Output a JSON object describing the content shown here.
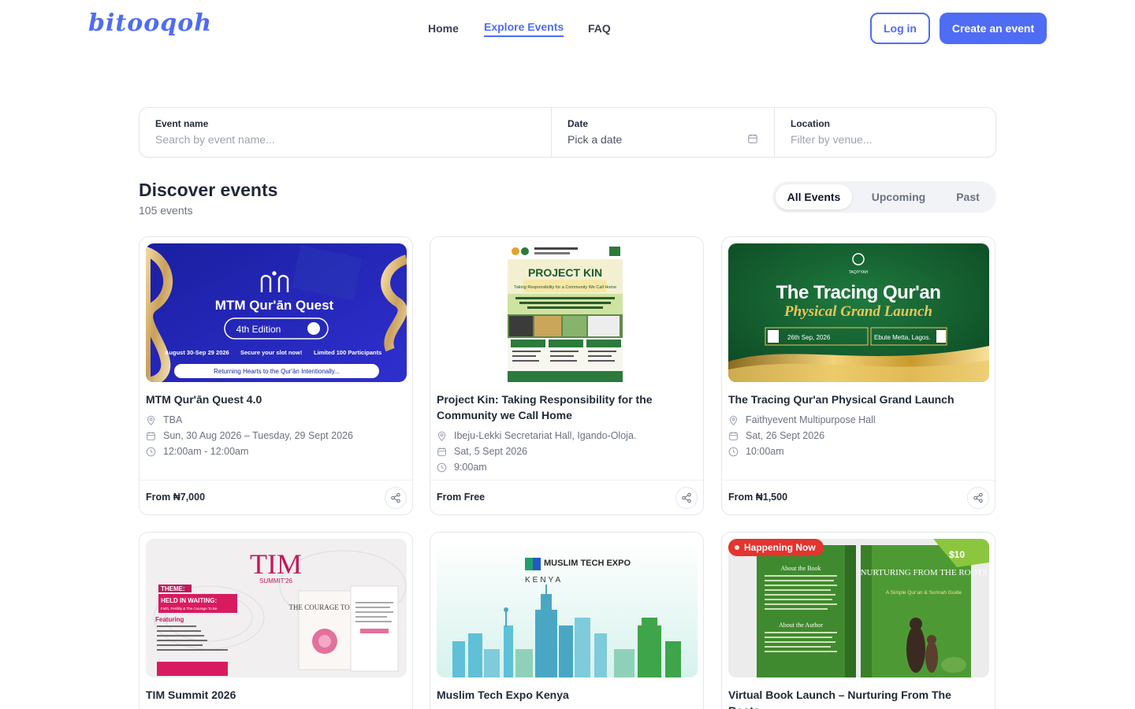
{
  "header": {
    "logo": "bitooqoh",
    "nav": [
      {
        "label": "Home"
      },
      {
        "label": "Explore Events"
      },
      {
        "label": "FAQ"
      }
    ],
    "login_label": "Log in",
    "create_label": "Create an event"
  },
  "search": {
    "event_name_label": "Event name",
    "event_name_placeholder": "Search by event name...",
    "date_label": "Date",
    "date_value": "Pick a date",
    "location_label": "Location",
    "location_placeholder": "Filter by venue..."
  },
  "discover": {
    "title": "Discover events",
    "count": "105 events",
    "tabs": [
      "All Events",
      "Upcoming",
      "Past"
    ],
    "active_tab": "All Events"
  },
  "events": [
    {
      "title": "MTM Qur'ān Quest 4.0",
      "location": "TBA",
      "date": "Sun, 30 Aug 2026 – Tuesday, 29 Sept 2026",
      "time": "12:00am - 12:00am",
      "price": "From ₦7,000",
      "image": {
        "heading": "MTM Qur'ān Quest",
        "edition": "4th Edition",
        "info": [
          "August 30-Sep 29 2026",
          "Secure your slot now!",
          "Limited 100 Participants"
        ],
        "tagline": "Returning Hearts to the Qur'ān Intentionally..."
      }
    },
    {
      "title": "Project Kin: Taking Responsibility for the Community we Call Home",
      "location": "Ibeju-Lekki Secretariat Hall, Igando-Oloja.",
      "date": "Sat, 5 Sept 2026",
      "time": "9:00am",
      "price": "From Free",
      "image": {
        "heading": "PROJECT KIN",
        "subheading": "Taking Responsibility for a Community We Call Home"
      }
    },
    {
      "title": "The Tracing Qur'an Physical Grand Launch",
      "location": "Faithyevent Multipurpose Hall",
      "date": "Sat, 26 Sept 2026",
      "time": "10:00am",
      "price": "From ₦1,500",
      "image": {
        "brand": "TAQIYYAH",
        "heading": "The Tracing Qur'an",
        "subheading": "Physical Grand Launch",
        "date_chip": "26th Sep, 2026",
        "location_chip": "Ebute Metta, Lagos."
      }
    },
    {
      "title": "TIM Summit 2026",
      "image": {
        "heading": "TIM",
        "sub": "SUMMIT'26",
        "theme_label": "THEME:",
        "theme": "HELD IN WAITING:",
        "theme_sub": "Faith, Fertility & The Courage To Be",
        "featuring": "Featuring",
        "book": "THE COURAGE TO BE"
      }
    },
    {
      "title": "Muslim Tech Expo Kenya",
      "image": {
        "heading": "MUSLIM TECH EXPO",
        "country": "KENYA"
      }
    },
    {
      "title": "Virtual Book Launch – Nurturing From The Roots",
      "badge": "Happening Now",
      "image": {
        "about_book": "About the Book",
        "about_author": "About the Author",
        "book_title": "NURTURING FROM THE ROOTS",
        "book_sub": "A Simple Qur'an & Sunnah Guide",
        "price_tag": "$10"
      }
    }
  ],
  "colors": {
    "accent": "#4f6cf5",
    "live_badge": "#e3342f"
  },
  "icons": [
    "calendar-icon",
    "location-pin-icon",
    "clock-icon",
    "share-icon"
  ]
}
